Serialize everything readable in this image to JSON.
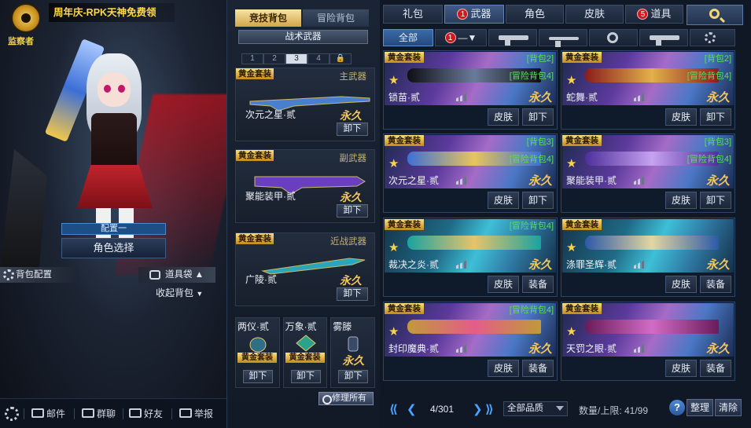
{
  "left": {
    "logo_text": "监察者",
    "promo_text": "周年庆-RPK天神免费领",
    "config_tag": "配置一",
    "role_select": "角色选择",
    "bag_config": "背包配置",
    "item_bag": "道具袋",
    "collapse_bag": "收起背包",
    "bottom": {
      "mail": "邮件",
      "group_chat": "群聊",
      "friends": "好友",
      "report": "举报"
    }
  },
  "middle": {
    "tabs": [
      "竞技背包",
      "冒险背包"
    ],
    "tactical": "战术武器",
    "slots": [
      "1",
      "2",
      "3",
      "4"
    ],
    "active_slot": "3",
    "weapons": [
      {
        "tag": "黄金套装",
        "type": "主武器",
        "name": "次元之星·贰",
        "perm": "永久",
        "action": "卸下"
      },
      {
        "tag": "黄金套装",
        "type": "副武器",
        "name": "聚能装甲·贰",
        "perm": "永久",
        "action": "卸下"
      },
      {
        "tag": "黄金套装",
        "type": "近战武器",
        "name": "广陵·贰",
        "perm": "永久",
        "action": "卸下"
      }
    ],
    "mini": [
      {
        "name": "两仪·贰",
        "tag": "黄金套装",
        "action": "卸下"
      },
      {
        "name": "万象·贰",
        "tag": "黄金套装",
        "action": "卸下"
      },
      {
        "name": "雾滕",
        "perm": "永久",
        "action": "卸下"
      }
    ],
    "repair": "修理所有"
  },
  "right": {
    "top_tabs": [
      {
        "label": "礼包",
        "badge": ""
      },
      {
        "label": "武器",
        "badge": "1"
      },
      {
        "label": "角色",
        "badge": ""
      },
      {
        "label": "皮肤",
        "badge": ""
      },
      {
        "label": "道具",
        "badge": "5"
      }
    ],
    "filter_all": "全部",
    "filter_badge": "1",
    "items": [
      {
        "tag": "黄金套装",
        "bag1": "[背包2]",
        "bag2": "[冒险背包4]",
        "name": "锁苗·贰",
        "perm": "永久",
        "skin": "皮肤",
        "action": "卸下",
        "theme": "purple"
      },
      {
        "tag": "黄金套装",
        "bag1": "[背包2]",
        "bag2": "[冒险背包4]",
        "name": "蛇舞·贰",
        "perm": "永久",
        "skin": "皮肤",
        "action": "卸下",
        "theme": "purple"
      },
      {
        "tag": "黄金套装",
        "bag1": "[背包3]",
        "bag2": "[冒险背包4]",
        "name": "次元之星·贰",
        "perm": "永久",
        "skin": "皮肤",
        "action": "卸下",
        "theme": "purple"
      },
      {
        "tag": "黄金套装",
        "bag1": "[背包3]",
        "bag2": "[冒险背包4]",
        "name": "聚能装甲·贰",
        "perm": "永久",
        "skin": "皮肤",
        "action": "卸下",
        "theme": "purple"
      },
      {
        "tag": "黄金套装",
        "bag1": "[冒险背包4]",
        "bag2": "",
        "name": "裁决之炎·贰",
        "perm": "永久",
        "skin": "皮肤",
        "action": "装备",
        "theme": "blue"
      },
      {
        "tag": "黄金套装",
        "bag1": "",
        "bag2": "",
        "name": "涤罪圣辉·贰",
        "perm": "永久",
        "skin": "皮肤",
        "action": "装备",
        "theme": "blue"
      },
      {
        "tag": "黄金套装",
        "bag1": "[冒险背包4]",
        "bag2": "",
        "name": "封印魔典·贰",
        "perm": "永久",
        "skin": "皮肤",
        "action": "装备",
        "theme": "purple"
      },
      {
        "tag": "黄金套装",
        "bag1": "",
        "bag2": "",
        "name": "天罚之眼·贰",
        "perm": "永久",
        "skin": "皮肤",
        "action": "装备",
        "theme": "purple"
      }
    ],
    "pager": {
      "page": "4/301",
      "quality": "全部品质",
      "capacity": "数量/上限: 41/99",
      "help": "?",
      "sort": "整理",
      "clear": "清除"
    }
  }
}
